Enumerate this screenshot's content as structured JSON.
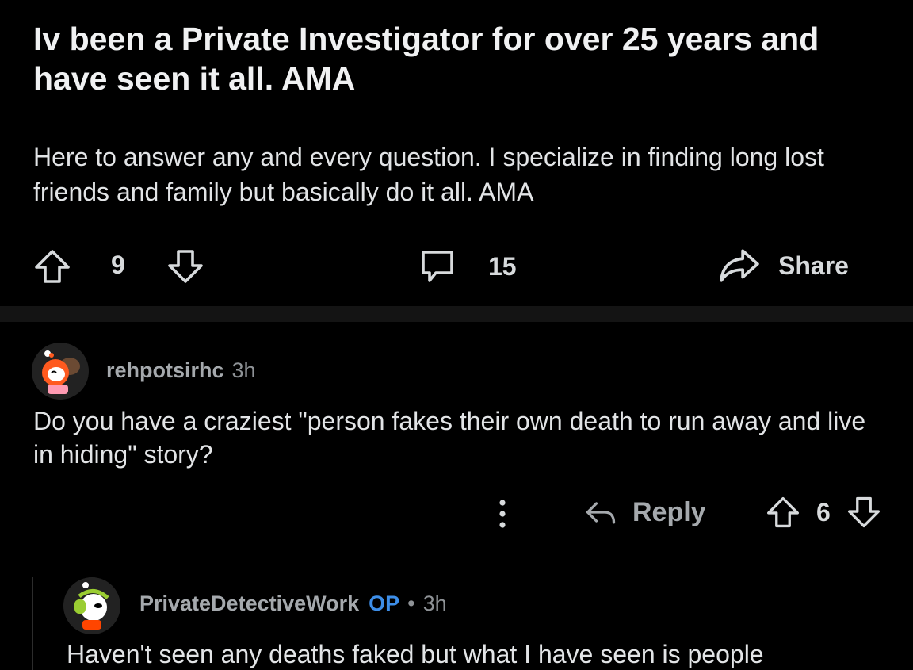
{
  "post": {
    "title": "Iv been a Private Investigator for over 25 years and have seen it all. AMA",
    "body": "Here to answer any and every question. I specialize in finding long lost friends and family but basically do it all. AMA",
    "votes": "9",
    "comments": "15",
    "share_label": "Share"
  },
  "comments": [
    {
      "username": "rehpotsirhc",
      "time": "3h",
      "text": "Do you have a craziest \"person fakes their own death to run away and live in hiding\" story?",
      "reply_label": "Reply",
      "votes": "6"
    },
    {
      "username": "PrivateDetectiveWork",
      "op_badge": "OP",
      "separator": "•",
      "time": "3h",
      "text": "Haven't seen any deaths faked but what I have seen is people"
    }
  ],
  "icons": {
    "upvote": "upvote-arrow-icon",
    "downvote": "downvote-arrow-icon",
    "comment": "comment-bubble-icon",
    "share": "share-arrow-icon",
    "more": "more-vertical-icon",
    "reply": "reply-arrow-icon"
  },
  "colors": {
    "background": "#000000",
    "divider": "#141414",
    "op_badge": "#3d8ee8",
    "text": "#e2e4e6",
    "muted": "#a5a9ad"
  }
}
